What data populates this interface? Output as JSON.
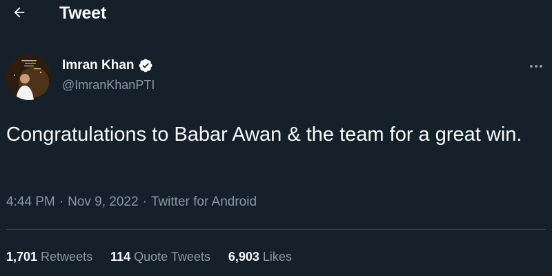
{
  "header": {
    "title": "Tweet",
    "back_icon": "arrow-left-icon"
  },
  "author": {
    "name": "Imran Khan",
    "handle": "@ImranKhanPTI",
    "verified": true,
    "verified_icon": "verified-badge-icon"
  },
  "more_icon": "more-horizontal-icon",
  "tweet": {
    "text": "Congratulations to Babar Awan & the team for a great win.",
    "time": "4:44 PM",
    "date": "Nov 9, 2022",
    "source": "Twitter for Android",
    "separator": "·"
  },
  "stats": [
    {
      "count": "1,701",
      "label": "Retweets"
    },
    {
      "count": "114",
      "label": "Quote Tweets"
    },
    {
      "count": "6,903",
      "label": "Likes"
    }
  ],
  "colors": {
    "background": "#15202b",
    "text_primary": "#f7f9f9",
    "text_secondary": "#8b98a5",
    "divider": "#38444d",
    "verified_badge": "#ffffff"
  }
}
